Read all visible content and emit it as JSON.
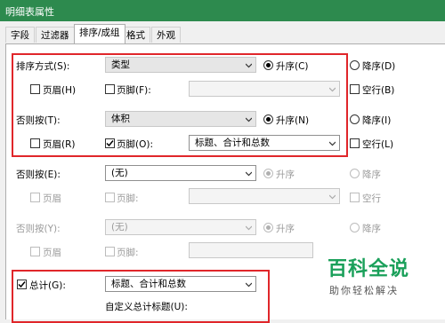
{
  "window": {
    "title": "明细表属性"
  },
  "tabs": [
    {
      "label": "字段"
    },
    {
      "label": "过滤器"
    },
    {
      "label": "排序/成组"
    },
    {
      "label": "格式"
    },
    {
      "label": "外观"
    }
  ],
  "sort": {
    "label": "排序方式(S):",
    "value": "类型",
    "asc": "升序(C)",
    "desc": "降序(D)",
    "header": "页眉(H)",
    "footer": "页脚(F):",
    "blank": "空行(B)"
  },
  "then1": {
    "label": "否则按(T):",
    "value": "体积",
    "asc": "升序(N)",
    "desc": "降序(I)",
    "header": "页眉(R)",
    "footer": "页脚(O):",
    "footer_value": "标题、合计和总数",
    "blank": "空行(L)"
  },
  "then2": {
    "label": "否则按(E):",
    "value": "(无)",
    "asc": "升序",
    "desc": "降序",
    "header": "页眉",
    "footer": "页脚:",
    "blank": "空行"
  },
  "then3": {
    "label": "否则按(Y):",
    "value": "(无)",
    "asc": "升序",
    "desc": "降序",
    "header": "页眉",
    "footer": "页脚:"
  },
  "total": {
    "label": "总计(G):",
    "value": "标题、合计和总数",
    "custom_title_label": "自定义总计标题(U):"
  },
  "watermark": {
    "title": "百科全说",
    "subtitle": "助你轻松解决"
  },
  "colors": {
    "titlebar": "#2d8a4e",
    "highlight": "#e0262a",
    "watermark": "#1aa05a"
  }
}
